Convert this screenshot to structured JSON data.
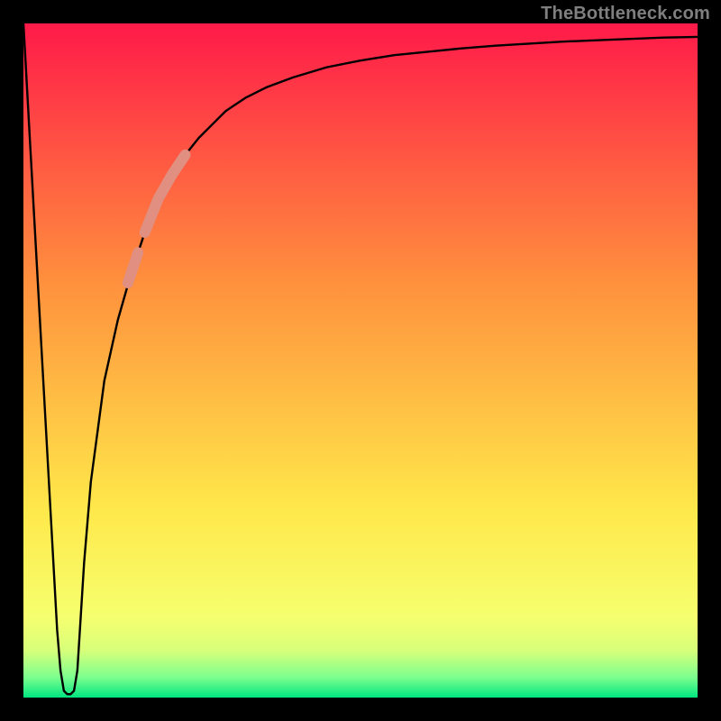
{
  "watermark": "TheBottleneck.com",
  "colors": {
    "background": "#000000",
    "watermark": "#7f7f7f",
    "curve": "#000000",
    "highlight": "#e08f81",
    "gradient_top": "#ff1a49",
    "gradient_mid_upper": "#ff8f3d",
    "gradient_mid": "#ffe84a",
    "gradient_low1": "#f6ff6e",
    "gradient_low2": "#d8ff7a",
    "gradient_low3": "#7cff8e",
    "gradient_bottom": "#00e580"
  },
  "chart_data": {
    "type": "line",
    "title": "",
    "xlabel": "",
    "ylabel": "",
    "xlim": [
      0,
      1
    ],
    "ylim": [
      0,
      1
    ],
    "grid": false,
    "legend": false,
    "series": [
      {
        "name": "bottleneck-curve",
        "x": [
          0.0,
          0.01,
          0.02,
          0.03,
          0.04,
          0.05,
          0.055,
          0.06,
          0.065,
          0.07,
          0.075,
          0.08,
          0.085,
          0.09,
          0.095,
          0.1,
          0.12,
          0.14,
          0.16,
          0.18,
          0.2,
          0.22,
          0.24,
          0.26,
          0.28,
          0.3,
          0.33,
          0.36,
          0.4,
          0.45,
          0.5,
          0.55,
          0.6,
          0.65,
          0.7,
          0.75,
          0.8,
          0.85,
          0.9,
          0.95,
          1.0
        ],
        "y": [
          1.0,
          0.82,
          0.64,
          0.46,
          0.28,
          0.1,
          0.04,
          0.01,
          0.005,
          0.005,
          0.01,
          0.04,
          0.12,
          0.2,
          0.26,
          0.32,
          0.47,
          0.56,
          0.63,
          0.69,
          0.74,
          0.775,
          0.805,
          0.83,
          0.85,
          0.87,
          0.89,
          0.905,
          0.92,
          0.935,
          0.945,
          0.953,
          0.958,
          0.963,
          0.967,
          0.97,
          0.973,
          0.975,
          0.977,
          0.979,
          0.98
        ]
      },
      {
        "name": "highlight-upper",
        "x": [
          0.18,
          0.2,
          0.22,
          0.24
        ],
        "y": [
          0.69,
          0.74,
          0.775,
          0.805
        ]
      },
      {
        "name": "highlight-lower",
        "x": [
          0.155,
          0.17
        ],
        "y": [
          0.615,
          0.66
        ]
      }
    ]
  }
}
